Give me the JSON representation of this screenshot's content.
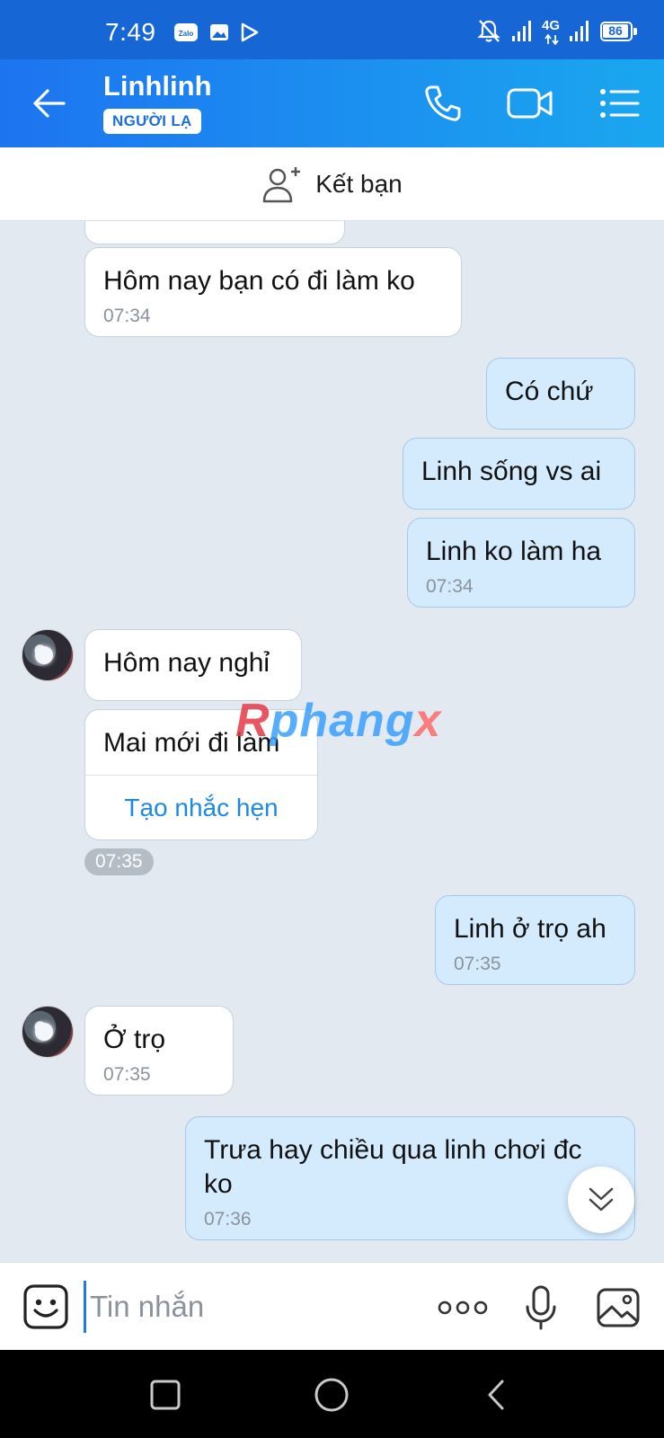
{
  "status_bar": {
    "time": "7:49",
    "battery": "86",
    "network": "4G",
    "icons": [
      "zalo-app-icon",
      "gallery-icon",
      "play-store-icon",
      "bell-muted-icon",
      "signal-icon",
      "signal-icon",
      "battery-icon"
    ]
  },
  "header": {
    "title": "Linhlinh",
    "badge": "NGƯỜI LẠ",
    "icons": [
      "back-arrow-icon",
      "phone-icon",
      "video-camera-icon",
      "menu-list-icon"
    ]
  },
  "add_friend": {
    "label": "Kết bạn",
    "icon": "add-person-icon"
  },
  "messages": [
    {
      "dir": "in",
      "text": "Hôm nay bạn có đi làm ko",
      "time": "07:34"
    },
    {
      "dir": "out",
      "text": "Có chứ",
      "time": ""
    },
    {
      "dir": "out",
      "text": "Linh sống vs ai",
      "time": ""
    },
    {
      "dir": "out",
      "text": "Linh ko làm ha",
      "time": "07:34"
    },
    {
      "dir": "in",
      "text": "Hôm nay nghỉ",
      "time": ""
    },
    {
      "dir": "in",
      "text": "Mai mới đi làm",
      "action": "Tạo nhắc hẹn",
      "time": "07:35"
    },
    {
      "dir": "out",
      "text": "Linh ở trọ ah",
      "time": "07:35"
    },
    {
      "dir": "in",
      "text": "Ở trọ",
      "time": "07:35"
    },
    {
      "dir": "out",
      "text": "Trưa hay chiều qua linh chơi đc ko",
      "time": "07:36"
    }
  ],
  "watermark": {
    "part1": "R",
    "part2": "phang",
    "part3": "x"
  },
  "input": {
    "placeholder": "Tin nhắn",
    "icons": [
      "emoji-sticker-icon",
      "more-dots-icon",
      "microphone-icon",
      "image-gallery-icon"
    ]
  },
  "nav": {
    "icons": [
      "recent-apps-icon",
      "home-icon",
      "back-icon"
    ]
  },
  "colors": {
    "header_start": "#1d74f0",
    "header_end": "#1aa7ef",
    "outgoing_bubble": "#d4ebfd",
    "chat_bg": "#e2e9f1",
    "link": "#1e88e5"
  }
}
